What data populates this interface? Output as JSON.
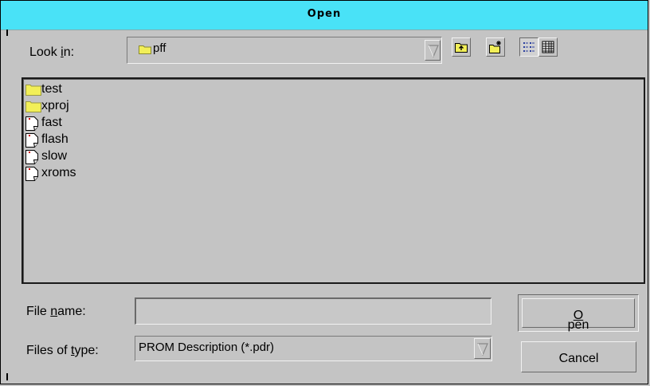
{
  "dialog": {
    "title": "Open"
  },
  "look_in": {
    "label_prefix": "Look ",
    "label_mnemonic": "i",
    "label_suffix": "n:",
    "value": "pff",
    "folder_icon": "folder-icon",
    "dropdown_icon": "chevron-down-icon"
  },
  "toolbar": {
    "up_one_level_icon": "folder-up-icon",
    "new_folder_icon": "new-folder-icon",
    "list_view_icon": "list-view-icon",
    "details_view_icon": "details-view-icon",
    "active_view": "list"
  },
  "file_list": {
    "items": [
      {
        "name": "test",
        "icon": "folder-icon"
      },
      {
        "name": "xproj",
        "icon": "folder-icon"
      },
      {
        "name": "fast",
        "icon": "file-icon"
      },
      {
        "name": "flash",
        "icon": "file-icon"
      },
      {
        "name": "slow",
        "icon": "file-icon"
      },
      {
        "name": "xroms",
        "icon": "file-icon"
      }
    ]
  },
  "file_name": {
    "label_prefix": "File ",
    "label_mnemonic": "n",
    "label_suffix": "ame:",
    "value": ""
  },
  "file_type": {
    "label_prefix": "Files of ",
    "label_mnemonic": "t",
    "label_suffix": "ype:",
    "value": "PROM Description (*.pdr)"
  },
  "buttons": {
    "open_mnemonic": "O",
    "open_rest": "pen",
    "cancel": "Cancel"
  },
  "colors": {
    "title_bar": "#49e2f7",
    "background": "#c4c4c4",
    "folder": "#f2ef58"
  }
}
